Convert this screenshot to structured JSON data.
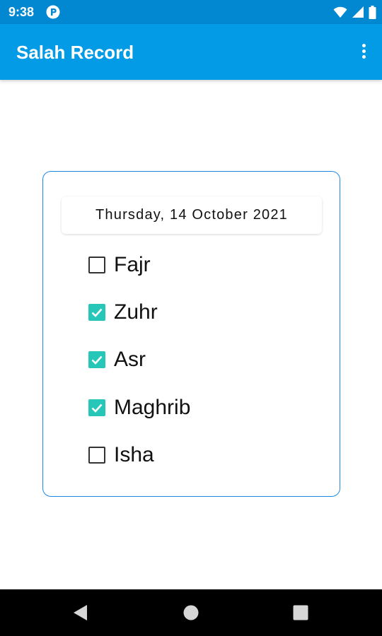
{
  "status_bar": {
    "time": "9:38",
    "icons": [
      "p-app-icon",
      "wifi-icon",
      "cellular-signal-icon",
      "battery-icon"
    ]
  },
  "app_bar": {
    "title": "Salah Record",
    "menu_icon": "more-vert-icon"
  },
  "card": {
    "date": "Thursday, 14 October 2021",
    "prayers": [
      {
        "label": "Fajr",
        "checked": false
      },
      {
        "label": "Zuhr",
        "checked": true
      },
      {
        "label": "Asr",
        "checked": true
      },
      {
        "label": "Maghrib",
        "checked": true
      },
      {
        "label": "Isha",
        "checked": false
      }
    ]
  },
  "nav_bar": {
    "icons": [
      "back-icon",
      "home-icon",
      "recents-icon"
    ]
  },
  "colors": {
    "status_bar": "#0288d1",
    "app_bar": "#039be5",
    "checkbox_checked": "#26c6b8",
    "card_border": "#1e88e5"
  }
}
